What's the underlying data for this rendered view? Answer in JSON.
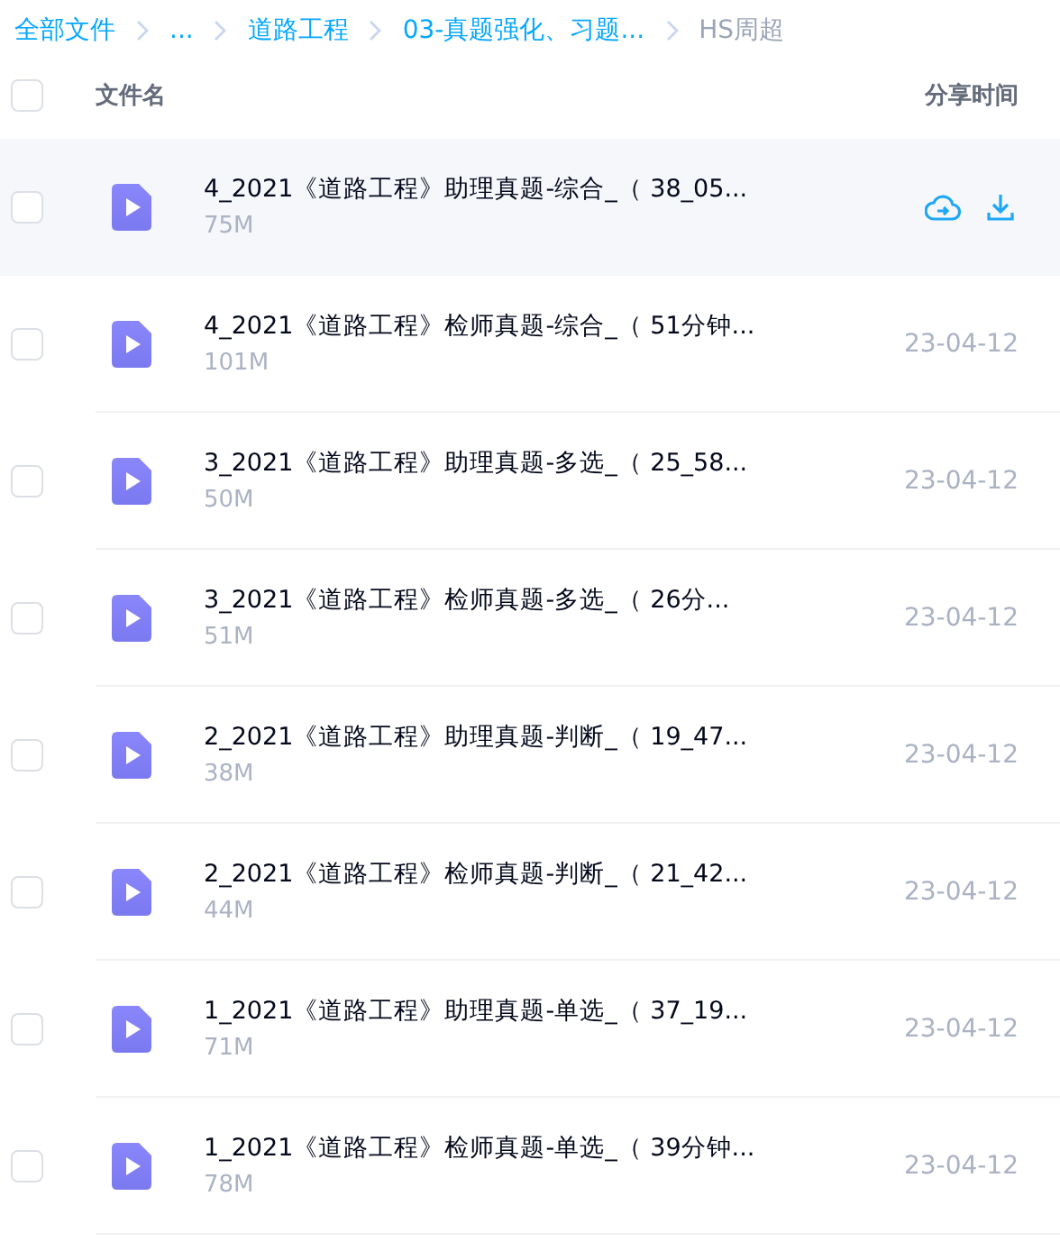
{
  "breadcrumb": [
    {
      "label": "全部文件",
      "current": false
    },
    {
      "label": "...",
      "current": false
    },
    {
      "label": "道路工程",
      "current": false
    },
    {
      "label": "03-真题强化、习题...",
      "current": false
    },
    {
      "label": "HS周超",
      "current": true
    }
  ],
  "table": {
    "columns": [
      "文件名",
      "分享时间"
    ],
    "select_all": {
      "checked": false
    },
    "rows": [
      {
        "name": "4_2021《道路工程》助理真题-综合_（ 38_05...",
        "size": "75M",
        "hovered": true,
        "checked": false
      },
      {
        "name": "4_2021《道路工程》检师真题-综合_（ 51分钟...",
        "size": "101M",
        "date": "23-04-12",
        "hovered": false,
        "checked": false
      },
      {
        "name": "3_2021《道路工程》助理真题-多选_（ 25_58...",
        "size": "50M",
        "date": "23-04-12",
        "hovered": false,
        "checked": false
      },
      {
        "name": "3_2021《道路工程》检师真题-多选_（ 26分...",
        "size": "51M",
        "date": "23-04-12",
        "hovered": false,
        "checked": false
      },
      {
        "name": "2_2021《道路工程》助理真题-判断_（ 19_47...",
        "size": "38M",
        "date": "23-04-12",
        "hovered": false,
        "checked": false
      },
      {
        "name": "2_2021《道路工程》检师真题-判断_（ 21_42...",
        "size": "44M",
        "date": "23-04-12",
        "hovered": false,
        "checked": false
      },
      {
        "name": "1_2021《道路工程》助理真题-单选_（ 37_19...",
        "size": "71M",
        "date": "23-04-12",
        "hovered": false,
        "checked": false
      },
      {
        "name": "1_2021《道路工程》检师真题-单选_（ 39分钟...",
        "size": "78M",
        "date": "23-04-12",
        "hovered": false,
        "checked": false
      }
    ]
  }
}
